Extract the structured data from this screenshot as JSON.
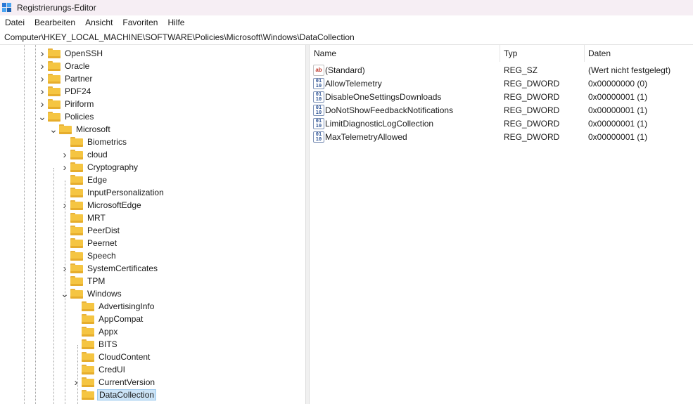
{
  "window": {
    "title": "Registrierungs-Editor"
  },
  "menu": {
    "items": [
      "Datei",
      "Bearbeiten",
      "Ansicht",
      "Favoriten",
      "Hilfe"
    ]
  },
  "address": {
    "path": "Computer\\HKEY_LOCAL_MACHINE\\SOFTWARE\\Policies\\Microsoft\\Windows\\DataCollection"
  },
  "tree": {
    "items": [
      {
        "label": "OpenSSH",
        "level": 0,
        "expand": "collapsed"
      },
      {
        "label": "Oracle",
        "level": 0,
        "expand": "collapsed"
      },
      {
        "label": "Partner",
        "level": 0,
        "expand": "collapsed"
      },
      {
        "label": "PDF24",
        "level": 0,
        "expand": "collapsed"
      },
      {
        "label": "Piriform",
        "level": 0,
        "expand": "collapsed"
      },
      {
        "label": "Policies",
        "level": 0,
        "expand": "expanded"
      },
      {
        "label": "Microsoft",
        "level": 1,
        "expand": "expanded"
      },
      {
        "label": "Biometrics",
        "level": 2,
        "expand": "none"
      },
      {
        "label": "cloud",
        "level": 2,
        "expand": "collapsed"
      },
      {
        "label": "Cryptography",
        "level": 2,
        "expand": "collapsed"
      },
      {
        "label": "Edge",
        "level": 2,
        "expand": "none"
      },
      {
        "label": "InputPersonalization",
        "level": 2,
        "expand": "none"
      },
      {
        "label": "MicrosoftEdge",
        "level": 2,
        "expand": "collapsed"
      },
      {
        "label": "MRT",
        "level": 2,
        "expand": "none"
      },
      {
        "label": "PeerDist",
        "level": 2,
        "expand": "none"
      },
      {
        "label": "Peernet",
        "level": 2,
        "expand": "none"
      },
      {
        "label": "Speech",
        "level": 2,
        "expand": "none"
      },
      {
        "label": "SystemCertificates",
        "level": 2,
        "expand": "collapsed"
      },
      {
        "label": "TPM",
        "level": 2,
        "expand": "none"
      },
      {
        "label": "Windows",
        "level": 2,
        "expand": "expanded"
      },
      {
        "label": "AdvertisingInfo",
        "level": 3,
        "expand": "none"
      },
      {
        "label": "AppCompat",
        "level": 3,
        "expand": "none"
      },
      {
        "label": "Appx",
        "level": 3,
        "expand": "none"
      },
      {
        "label": "BITS",
        "level": 3,
        "expand": "none"
      },
      {
        "label": "CloudContent",
        "level": 3,
        "expand": "none"
      },
      {
        "label": "CredUI",
        "level": 3,
        "expand": "none"
      },
      {
        "label": "CurrentVersion",
        "level": 3,
        "expand": "collapsed"
      },
      {
        "label": "DataCollection",
        "level": 3,
        "expand": "none",
        "selected": true
      }
    ]
  },
  "list": {
    "columns": {
      "name": "Name",
      "type": "Typ",
      "data": "Daten"
    },
    "rows": [
      {
        "name": "(Standard)",
        "type": "REG_SZ",
        "data": "(Wert nicht festgelegt)",
        "icon": "string-value-icon"
      },
      {
        "name": "AllowTelemetry",
        "type": "REG_DWORD",
        "data": "0x00000000 (0)",
        "icon": "binary-value-icon"
      },
      {
        "name": "DisableOneSettingsDownloads",
        "type": "REG_DWORD",
        "data": "0x00000001 (1)",
        "icon": "binary-value-icon"
      },
      {
        "name": "DoNotShowFeedbackNotifications",
        "type": "REG_DWORD",
        "data": "0x00000001 (1)",
        "icon": "binary-value-icon"
      },
      {
        "name": "LimitDiagnosticLogCollection",
        "type": "REG_DWORD",
        "data": "0x00000001 (1)",
        "icon": "binary-value-icon"
      },
      {
        "name": "MaxTelemetryAllowed",
        "type": "REG_DWORD",
        "data": "0x00000001 (1)",
        "icon": "binary-value-icon"
      }
    ]
  },
  "colors": {
    "selection": "#cce4f7",
    "folder": "#f5c542",
    "titlebar": "#f6eef4"
  }
}
